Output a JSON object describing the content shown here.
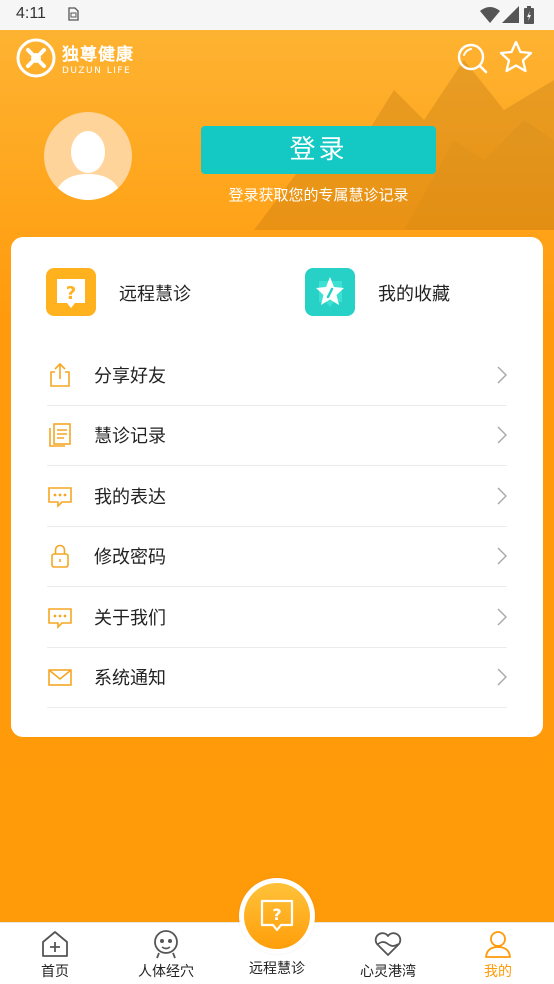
{
  "status_bar": {
    "time": "4:11"
  },
  "header": {
    "brand_cn": "独尊健康",
    "brand_en": "DUZUN LIFE",
    "search_icon": "search-icon",
    "favorite_icon": "star-icon"
  },
  "profile": {
    "login_label": "登录",
    "login_hint": "登录获取您的专属慧诊记录"
  },
  "quick_actions": [
    {
      "label": "远程慧诊",
      "icon": "question-chat-icon",
      "color": "#ffb21e"
    },
    {
      "label": "我的收藏",
      "icon": "star-badge-icon",
      "color": "#27d1c6"
    }
  ],
  "menu": [
    {
      "label": "分享好友",
      "icon": "share-icon"
    },
    {
      "label": "慧诊记录",
      "icon": "records-icon"
    },
    {
      "label": "我的表达",
      "icon": "chat-bubble-icon"
    },
    {
      "label": "修改密码",
      "icon": "lock-icon"
    },
    {
      "label": "关于我们",
      "icon": "chat-bubble-icon"
    },
    {
      "label": "系统通知",
      "icon": "mail-icon"
    }
  ],
  "tabbar": {
    "tabs": [
      {
        "label": "首页",
        "icon": "home-icon"
      },
      {
        "label": "人体经穴",
        "icon": "body-icon"
      },
      {
        "label": "远程慧诊",
        "icon": "question-chat-icon"
      },
      {
        "label": "心灵港湾",
        "icon": "heart-icon"
      },
      {
        "label": "我的",
        "icon": "user-icon",
        "active": true
      }
    ]
  },
  "colors": {
    "primary": "#ff9a08",
    "accent_teal": "#14c9c3",
    "icon_orange": "#f5a623"
  }
}
